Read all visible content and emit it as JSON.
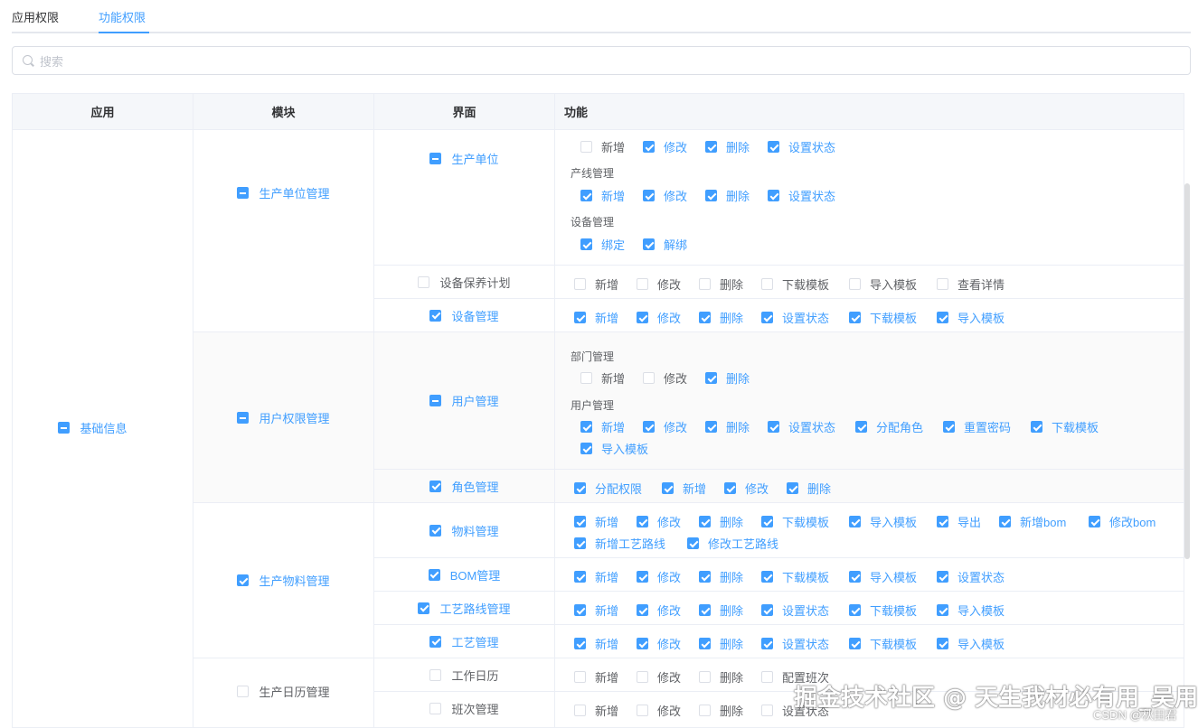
{
  "tabs": [
    {
      "label": "应用权限"
    },
    {
      "label": "功能权限"
    }
  ],
  "search": {
    "placeholder": "搜索"
  },
  "columns": {
    "app": "应用",
    "module": "模块",
    "view": "界面",
    "func": "功能"
  },
  "app": {
    "label": "基础信息"
  },
  "modules": {
    "m1": "生产单位管理",
    "m2": "用户权限管理",
    "m3": "生产物料管理",
    "m4": "生产日历管理"
  },
  "views": {
    "v1": "生产单位",
    "v2": "设备保养计划",
    "v3": "设备管理",
    "v4": "用户管理",
    "v5": "角色管理",
    "v6": "物料管理",
    "v7": "BOM管理",
    "v8": "工艺路线管理",
    "v9": "工艺管理",
    "v10": "工作日历",
    "v11": "班次管理"
  },
  "groups": {
    "g1": "产线管理",
    "g2": "设备管理",
    "g3": "部门管理",
    "g4": "用户管理"
  },
  "f": {
    "xinzeng": "新增",
    "xiugai": "修改",
    "shanchu": "删除",
    "shezhi": "设置状态",
    "bangding": "绑定",
    "jiebang": "解绑",
    "xiazai": "下载模板",
    "daoru": "导入模板",
    "chakan": "查看详情",
    "fenpeijuese": "分配角色",
    "chongzhi": "重置密码",
    "fenpeiquanxian": "分配权限",
    "daochu": "导出",
    "xinzengbom": "新增bom",
    "xiugaibom": "修改bom",
    "xinzenggy": "新增工艺路线",
    "xiugaigy": "修改工艺路线",
    "peizhi": "配置班次"
  },
  "watermark": {
    "main": "掘金技术社区 @ 天生我材必有用_吴用",
    "sub": "CSDN @秋田君"
  },
  "colors": {
    "accent": "#409eff",
    "border": "#ebeef5",
    "header_bg": "#f5f7fa"
  }
}
